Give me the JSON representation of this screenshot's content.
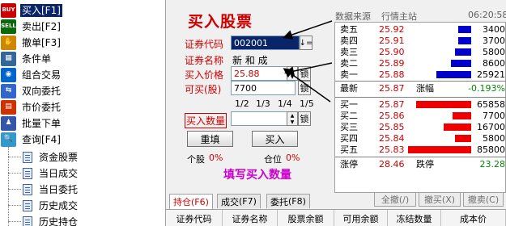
{
  "nav": {
    "items": [
      {
        "label": "买入[F1]",
        "icon": "buy-icon",
        "icon_text": "BUY"
      },
      {
        "label": "卖出[F2]",
        "icon": "sell-icon",
        "icon_text": "SELL"
      },
      {
        "label": "撤单[F3]",
        "icon": "cancel-hand-icon",
        "icon_text": "✋"
      },
      {
        "label": "条件单",
        "icon": "condition-icon",
        "icon_text": "▦"
      },
      {
        "label": "组合交易",
        "icon": "combo-icon",
        "icon_text": "◉"
      },
      {
        "label": "双向委托",
        "icon": "two-way-icon",
        "icon_text": "⇆"
      },
      {
        "label": "市价委托",
        "icon": "market-order-icon",
        "icon_text": "▤"
      },
      {
        "label": "批量下单",
        "icon": "batch-order-icon",
        "icon_text": "♟"
      },
      {
        "label": "查询[F4]",
        "icon": "query-icon",
        "icon_text": "🔍"
      }
    ],
    "sub_items": [
      {
        "label": "资金股票"
      },
      {
        "label": "当日成交"
      },
      {
        "label": "当日委托"
      },
      {
        "label": "历史成交"
      },
      {
        "label": "历史持仓"
      }
    ]
  },
  "form": {
    "title": "买入股票",
    "code_label": "证券代码",
    "code_value": "002001",
    "name_label": "证券名称",
    "name_value": "新 和 成",
    "price_label": "买入价格",
    "price_value": "25.88",
    "max_label": "可买(股)",
    "max_value": "7700",
    "fractions": [
      "1/2",
      "1/3",
      "1/4",
      "1/5"
    ],
    "qty_label": "买入数量",
    "qty_value": "",
    "lock": "锁",
    "code_btn": "↓=",
    "reset_label": "重填",
    "buy_label": "买入",
    "stock_pct_label": "个股",
    "stock_pct_value": "0%",
    "position_label": "仓位",
    "position_value": "0%",
    "hint": "填写买入数量"
  },
  "quote": {
    "source_label": "数据来源",
    "source_name": "行情主站",
    "time": "06:20:58",
    "sells": [
      {
        "level": "卖五",
        "price": "25.92",
        "volume": "3400",
        "bar_color": "#0000cc"
      },
      {
        "level": "卖四",
        "price": "25.91",
        "volume": "3700",
        "bar_color": "#0000cc"
      },
      {
        "level": "卖三",
        "price": "25.90",
        "volume": "5800",
        "bar_color": "#0000cc"
      },
      {
        "level": "卖二",
        "price": "25.89",
        "volume": "8600",
        "bar_color": "#0000cc"
      },
      {
        "level": "卖一",
        "price": "25.88",
        "volume": "25921",
        "bar_color": "#0000cc"
      }
    ],
    "latest_label": "最新",
    "latest_value": "25.87",
    "change_label": "涨幅",
    "change_value": "-0.193%",
    "buys": [
      {
        "level": "买一",
        "price": "25.87",
        "volume": "65858",
        "bar_color": "#ee0000"
      },
      {
        "level": "买二",
        "price": "25.86",
        "volume": "7700",
        "bar_color": "#ee0000"
      },
      {
        "level": "买三",
        "price": "25.85",
        "volume": "16700",
        "bar_color": "#ee0000"
      },
      {
        "level": "买四",
        "price": "25.84",
        "volume": "5800",
        "bar_color": "#ee0000"
      },
      {
        "level": "买五",
        "price": "25.83",
        "volume": "85800",
        "bar_color": "#ee0000"
      }
    ],
    "limit_up_label": "涨停",
    "limit_up_value": "28.46",
    "limit_down_label": "跌停",
    "limit_down_value": "23.28"
  },
  "tabs": {
    "hold": {
      "label": "持仓",
      "key": "(F6)"
    },
    "deal": {
      "label": "成交",
      "key": "(F7)"
    },
    "entrust": {
      "label": "委托",
      "key": "(F8)"
    }
  },
  "actions": {
    "cancel_all": "全撤(/)",
    "cancel_buy": "撤买(X)",
    "cancel_sell": "撤卖(C)"
  },
  "table": {
    "columns": [
      "证券代码",
      "证券名称",
      "股票余额",
      "可用余额",
      "冻结数量",
      "成本价"
    ]
  },
  "colors": {
    "accent_red": "#cc0000",
    "sell_bar": "#0000cc",
    "buy_bar": "#ee0000",
    "hint_magenta": "#cc00cc",
    "selection": "#0a246a"
  }
}
